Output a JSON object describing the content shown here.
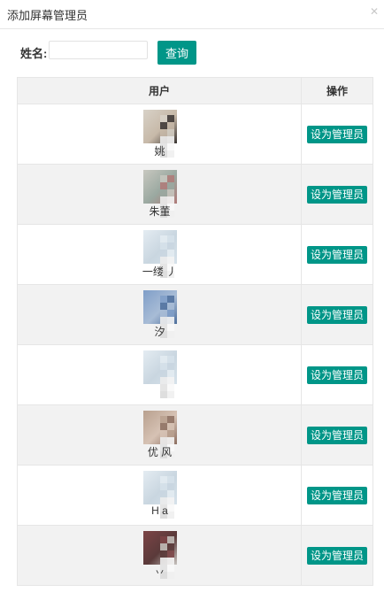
{
  "dialog": {
    "title": "添加屏幕管理员",
    "close_icon": "close-icon"
  },
  "search": {
    "label": "姓名:",
    "value": "",
    "placeholder": "",
    "button_label": "查询"
  },
  "table": {
    "headers": [
      "用户",
      "操作"
    ],
    "action_label": "设为管理员",
    "rows": [
      {
        "name": "姚",
        "avatar": "avatar-photo-1",
        "avatar_colors": [
          "#d8d2c8",
          "#3a3432",
          "#c7b9a8"
        ]
      },
      {
        "name": "朱董",
        "avatar": "avatar-photo-2",
        "avatar_colors": [
          "#c8c8c0",
          "#b07a78",
          "#9aa8a0"
        ]
      },
      {
        "name": "一缕 丿",
        "avatar": "avatar-default-3",
        "avatar_colors": [
          "#e4ecf2",
          "#d6e2ea",
          "#c9d6e0"
        ]
      },
      {
        "name": "汐",
        "avatar": "avatar-photo-4",
        "avatar_colors": [
          "#7f9ec8",
          "#4e6f9c",
          "#a8bcd6"
        ]
      },
      {
        "name": "",
        "avatar": "avatar-default-5",
        "avatar_colors": [
          "#e4ecf2",
          "#d6e2ea",
          "#c9d6e0"
        ]
      },
      {
        "name": "优 风",
        "avatar": "avatar-photo-6",
        "avatar_colors": [
          "#b8a08e",
          "#8c6e60",
          "#d6c2b4"
        ]
      },
      {
        "name": "H a",
        "avatar": "avatar-default-7",
        "avatar_colors": [
          "#e4ecf2",
          "#d6e2ea",
          "#c9d6e0"
        ]
      },
      {
        "name": "丷",
        "avatar": "avatar-photo-8",
        "avatar_colors": [
          "#7c4446",
          "#c8c4c0",
          "#5a3a3a"
        ]
      }
    ]
  }
}
